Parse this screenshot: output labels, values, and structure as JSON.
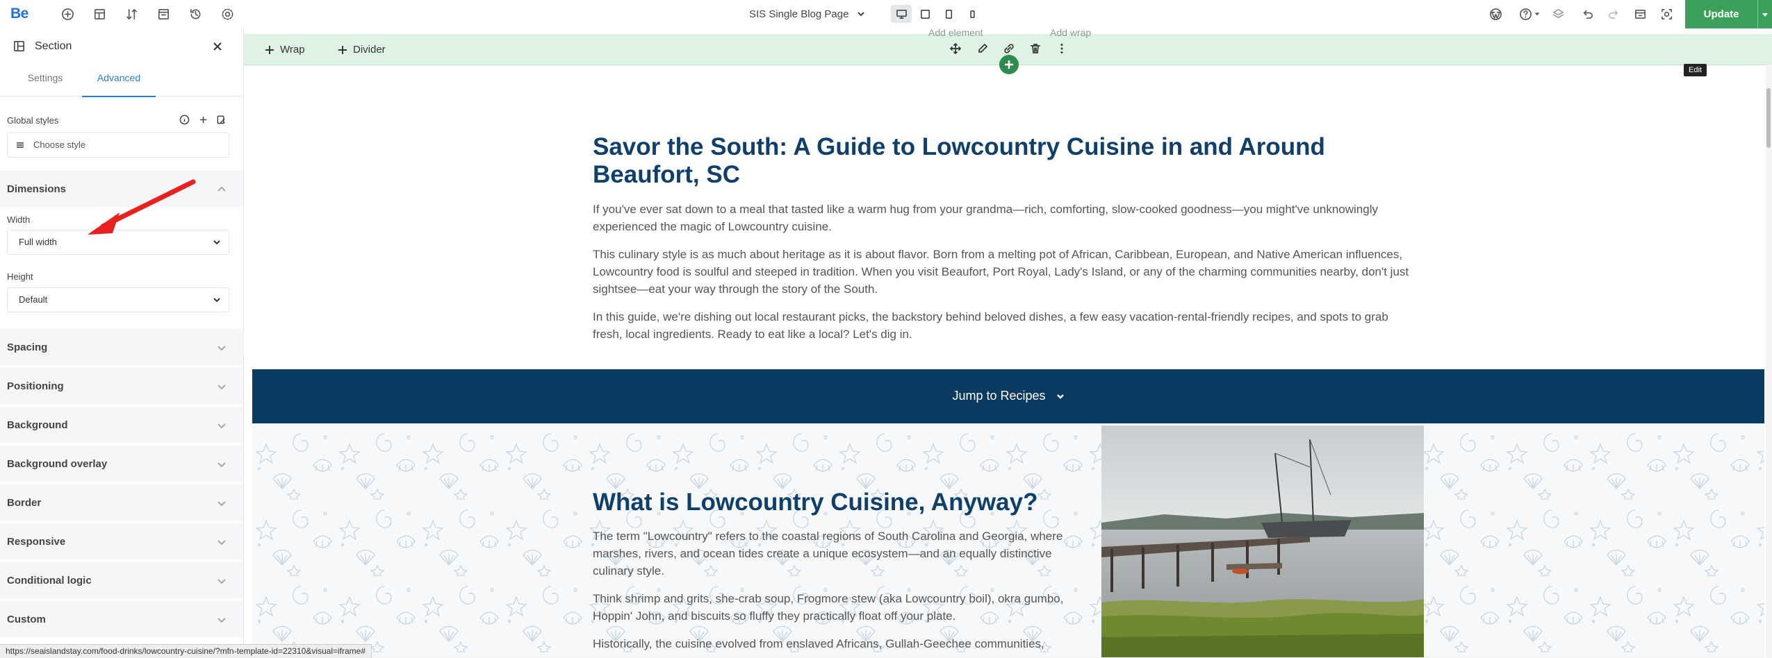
{
  "app": {
    "logo": "Be",
    "page_selector": "SIS Single Blog Page",
    "update_label": "Update"
  },
  "topbar": {
    "left_icons": [
      "add-icon",
      "layout-icon",
      "sort-icon",
      "template-icon",
      "history-icon",
      "settings-icon"
    ],
    "right_icons": [
      "wordpress-icon",
      "help-icon",
      "layers-icon",
      "undo-icon",
      "redo-icon",
      "preview-window-icon",
      "screenshot-icon"
    ],
    "devices": [
      "desktop",
      "tablet",
      "tablet-portrait",
      "mobile"
    ],
    "active_device": "desktop"
  },
  "panel": {
    "title": "Section",
    "tabs": [
      {
        "label": "Settings",
        "active": false
      },
      {
        "label": "Advanced",
        "active": true
      }
    ],
    "global_styles": {
      "label": "Global styles",
      "placeholder": "Choose style"
    },
    "dimensions": {
      "label": "Dimensions",
      "width_label": "Width",
      "width_value": "Full width",
      "height_label": "Height",
      "height_value": "Default"
    },
    "sections": [
      "Spacing",
      "Positioning",
      "Background",
      "Background overlay",
      "Border",
      "Responsive",
      "Conditional logic",
      "Custom"
    ]
  },
  "canvas": {
    "toolbar": {
      "ghost_labels": [
        "Add element",
        "Add wrap"
      ],
      "wrap_label": "Wrap",
      "divider_label": "Divider",
      "tooltip": "Edit"
    },
    "article": {
      "title": "Savor the South: A Guide to Lowcountry Cuisine in and Around Beaufort, SC",
      "paragraphs": [
        "If you've ever sat down to a meal that tasted like a warm hug from your grandma—rich, comforting, slow-cooked goodness—you might've unknowingly experienced the magic of Lowcountry cuisine.",
        "This culinary style is as much about heritage as it is about flavor. Born from a melting pot of African, Caribbean, European, and Native American influences, Lowcountry food is soulful and steeped in tradition. When you visit Beaufort, Port Royal, Lady's Island, or any of the charming communities nearby, don't just sightsee—eat your way through the story of the South.",
        "In this guide, we're dishing out local restaurant picks, the backstory behind beloved dishes, a few easy vacation-rental-friendly recipes, and spots to grab fresh, local ingredients. Ready to eat like a local? Let's dig in."
      ],
      "jump_label": "Jump to Recipes",
      "section2": {
        "title": "What is Lowcountry Cuisine, Anyway?",
        "paragraphs": [
          "The term \"Lowcountry\" refers to the coastal regions of South Carolina and Georgia, where marshes, rivers, and ocean tides create a unique ecosystem—and an equally distinctive culinary style.",
          "Think shrimp and grits, she-crab soup, Frogmore stew (aka Lowcountry boil), okra gumbo, Hoppin' John, and biscuits so fluffy they practically float off your plate.",
          "Historically, the cuisine evolved from enslaved Africans, Gullah-Geechee communities,"
        ]
      }
    }
  },
  "statusbar": {
    "url": "https://seaislandstay.com/food-drinks/lowcountry-cuisine/?mfn-template-id=22310&visual=iframe#"
  },
  "colors": {
    "accent_blue": "#2b7bd8",
    "heading_navy": "#0f3f6b",
    "band_navy": "#0a3a60",
    "update_green": "#3aa05a",
    "wrap_bar_green": "#dff3e4",
    "annotation_red": "#e82020"
  }
}
